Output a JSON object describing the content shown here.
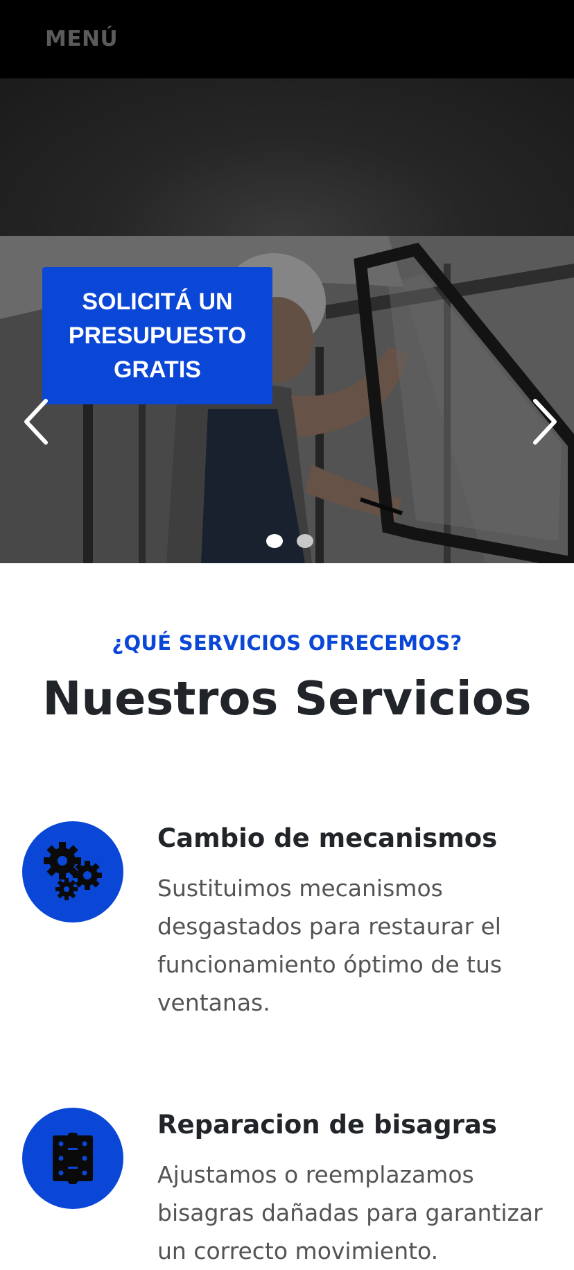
{
  "header": {
    "menu_label": "MENÚ"
  },
  "hero": {
    "cta_label": "SOLICITÁ UN PRESUPUESTO GRATIS",
    "prev_icon": "chevron-left-icon",
    "next_icon": "chevron-right-icon",
    "slide_count": 2,
    "active_slide": 1
  },
  "services_section": {
    "kicker": "¿QUÉ SERVICIOS OFRECEMOS?",
    "title": "Nuestros Servicios",
    "items": [
      {
        "icon": "gears-icon",
        "title": "Cambio de mecanismos",
        "description": "Sustituimos mecanismos desgastados para restaurar el funcionamiento óptimo de tus ventanas."
      },
      {
        "icon": "hinge-icon",
        "title": "Reparacion de bisagras",
        "description": "Ajustamos o reemplazamos bisagras dañadas para garantizar un correcto movimiento."
      }
    ]
  },
  "colors": {
    "accent": "#0b47d6",
    "topbar": "#000000",
    "heading": "#212529",
    "body_text": "#545454"
  }
}
